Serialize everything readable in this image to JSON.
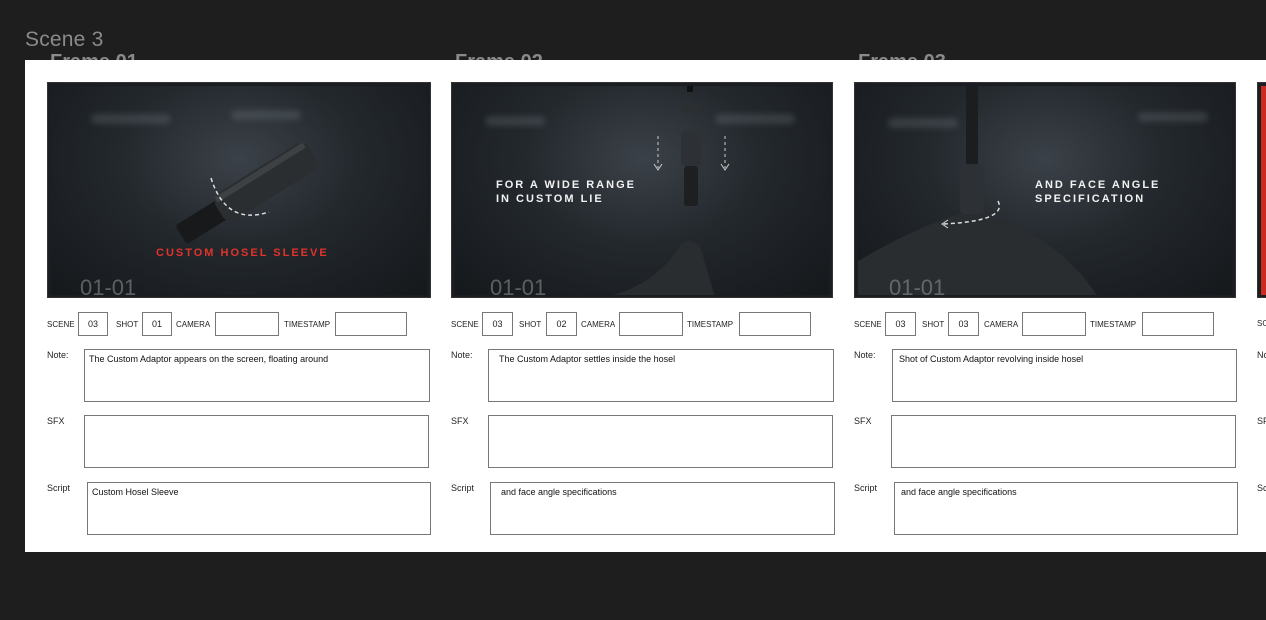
{
  "scene_title": "Scene 3",
  "frame_headers": [
    "Frame 01",
    "Frame 02",
    "Frame 03"
  ],
  "labels": {
    "scene": "SCENE",
    "shot": "SHOT",
    "camera": "CAMERA",
    "timestamp": "TIMESTAMP",
    "note": "Note:",
    "sfx": "SFX",
    "script": "Script"
  },
  "frames": [
    {
      "frame_number": "01-01",
      "caption": "CUSTOM HOSEL SLEEVE",
      "caption_color": "#e0332b",
      "scene": "03",
      "shot": "01",
      "camera": "",
      "timestamp": "",
      "note": "The Custom Adaptor appears on the screen, floating around",
      "sfx": "",
      "script": "Custom Hosel Sleeve"
    },
    {
      "frame_number": "01-01",
      "caption_line1": "FOR A WIDE RANGE",
      "caption_line2": "IN CUSTOM LIE",
      "scene": "03",
      "shot": "02",
      "camera": "",
      "timestamp": "",
      "note": "The Custom Adaptor settles inside the hosel",
      "sfx": "",
      "script": "and face angle specifications"
    },
    {
      "frame_number": "01-01",
      "caption_line1": "AND FACE ANGLE",
      "caption_line2": "SPECIFICATION",
      "scene": "03",
      "shot": "03",
      "camera": "",
      "timestamp": "",
      "note": "Shot of Custom Adaptor revolving inside hosel",
      "sfx": "",
      "script": "and face angle specifications"
    }
  ],
  "colors": {
    "background": "#1e1e1e",
    "board": "#ffffff",
    "accent_red": "#e0332b"
  }
}
